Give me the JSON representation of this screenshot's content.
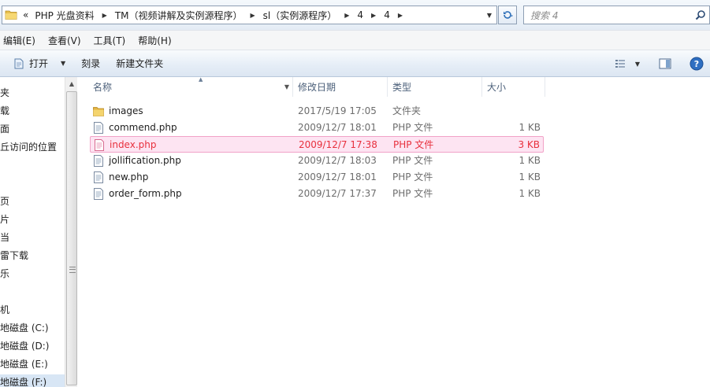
{
  "address": {
    "segments": [
      "«",
      "PHP 光盘资料",
      "TM（视频讲解及实例源程序）",
      "sl（实例源程序）",
      "4",
      "4"
    ],
    "search_placeholder": "搜索 4"
  },
  "menu": [
    {
      "label": "编辑(E)"
    },
    {
      "label": "查看(V)"
    },
    {
      "label": "工具(T)"
    },
    {
      "label": "帮助(H)"
    }
  ],
  "toolbar": {
    "open_label": "打开",
    "burn_label": "刻录",
    "new_folder_label": "新建文件夹"
  },
  "nav": {
    "items": [
      {
        "label": "夹"
      },
      {
        "label": "载"
      },
      {
        "label": "面"
      },
      {
        "label": "丘访问的位置"
      },
      {
        "label": "页"
      },
      {
        "label": "片"
      },
      {
        "label": "当"
      },
      {
        "label": "雷下载"
      },
      {
        "label": "乐"
      },
      {
        "label": "机"
      },
      {
        "label": "地磁盘 (C:)"
      },
      {
        "label": "地磁盘 (D:)"
      },
      {
        "label": "地磁盘 (E:)"
      },
      {
        "label": "地磁盘 (F:)"
      }
    ]
  },
  "columns": {
    "name": "名称",
    "date": "修改日期",
    "type": "类型",
    "size": "大小"
  },
  "files": [
    {
      "name": "images",
      "date": "2017/5/19 17:05",
      "type": "文件夹",
      "size": "",
      "icon": "folder-icon"
    },
    {
      "name": "commend.php",
      "date": "2009/12/7 18:01",
      "type": "PHP 文件",
      "size": "1 KB",
      "icon": "php-file-icon"
    },
    {
      "name": "index.php",
      "date": "2009/12/7 17:38",
      "type": "PHP 文件",
      "size": "3 KB",
      "icon": "php-file-icon"
    },
    {
      "name": "jollification.php",
      "date": "2009/12/7 18:03",
      "type": "PHP 文件",
      "size": "1 KB",
      "icon": "php-file-icon"
    },
    {
      "name": "new.php",
      "date": "2009/12/7 18:01",
      "type": "PHP 文件",
      "size": "1 KB",
      "icon": "php-file-icon"
    },
    {
      "name": "order_form.php",
      "date": "2009/12/7 17:37",
      "type": "PHP 文件",
      "size": "1 KB",
      "icon": "php-file-icon"
    }
  ],
  "colors": {
    "selected_row_bg": "#fde4f2",
    "selected_row_text": "#e8303d"
  }
}
